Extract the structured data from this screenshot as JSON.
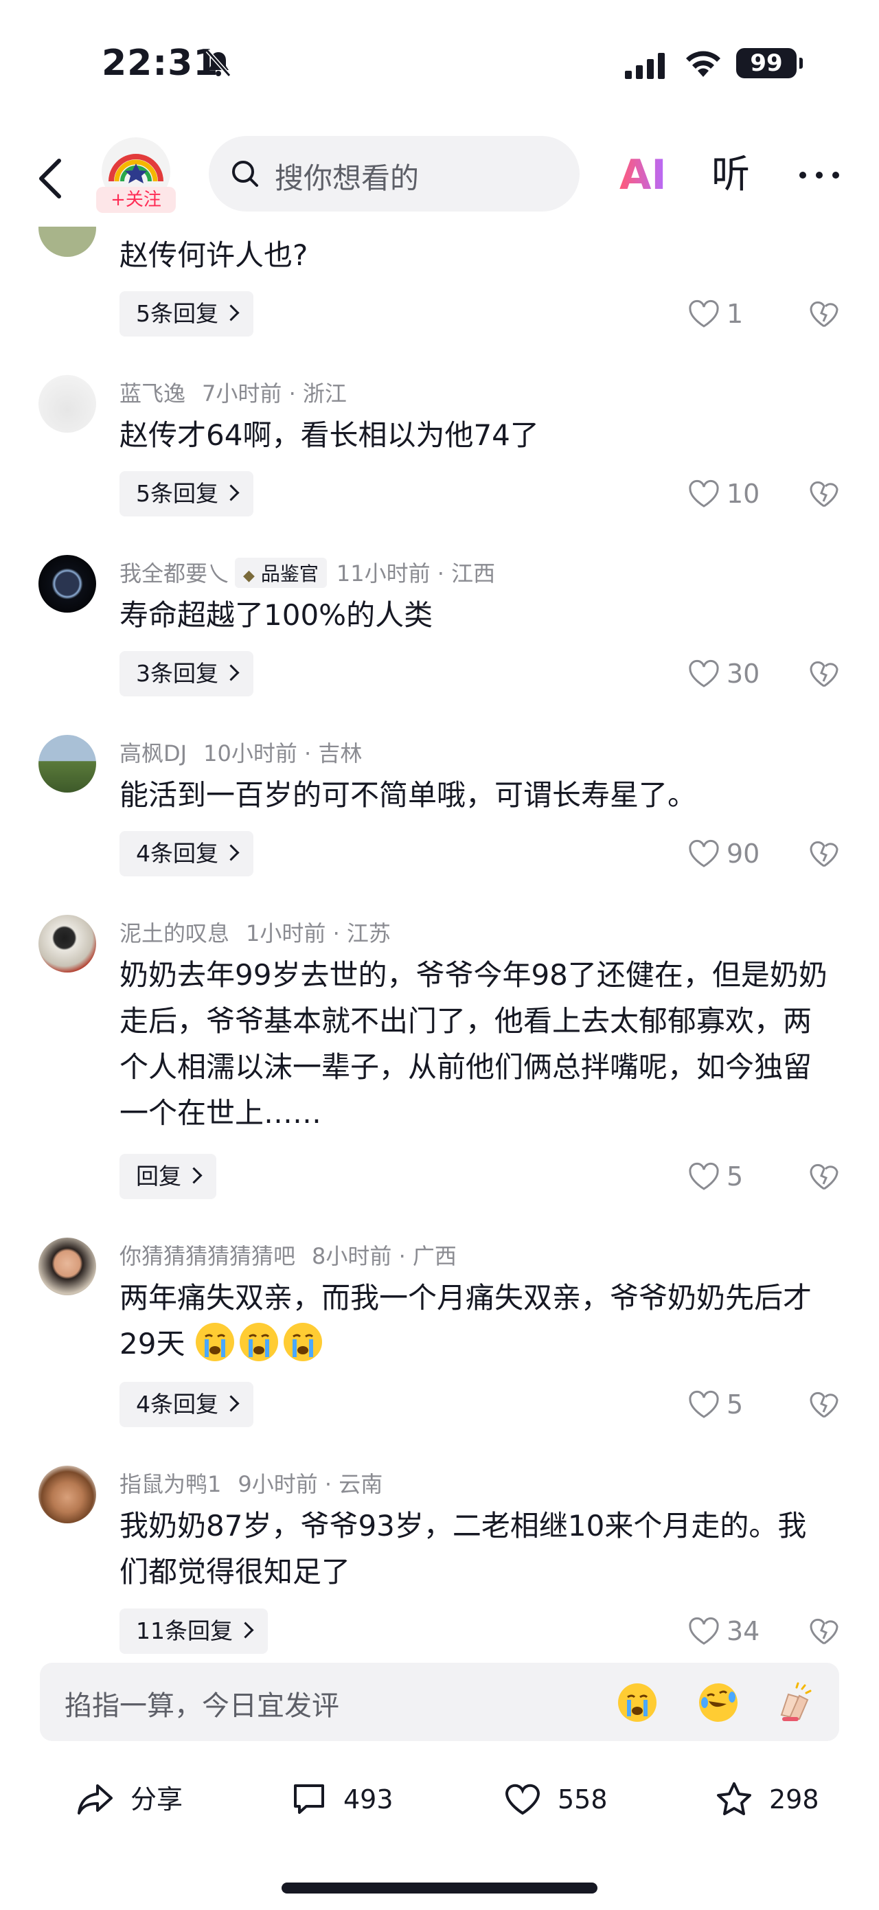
{
  "status": {
    "time": "22:31",
    "battery": "99"
  },
  "nav": {
    "follow_label": "+关注",
    "search_placeholder": "搜你想看的",
    "ai_label": "AI",
    "listen_label": "听"
  },
  "comments": [
    {
      "text": "赵传何许人也?",
      "replies": "5条回复",
      "likes": "1"
    },
    {
      "user": "蓝飞逸",
      "time": "7小时前",
      "location": "浙江",
      "text": "赵传才64啊，看长相以为他74了",
      "replies": "5条回复",
      "likes": "10"
    },
    {
      "user": "我全都要乀",
      "badge": "品鉴官",
      "time": "11小时前",
      "location": "江西",
      "text": "寿命超越了100%的人类",
      "replies": "3条回复",
      "likes": "30"
    },
    {
      "user": "高枫DJ",
      "time": "10小时前",
      "location": "吉林",
      "text": "能活到一百岁的可不简单哦，可谓长寿星了。",
      "replies": "4条回复",
      "likes": "90"
    },
    {
      "user": "泥土的叹息",
      "time": "1小时前",
      "location": "江苏",
      "text": "奶奶去年99岁去世的，爷爷今年98了还健在，但是奶奶走后，爷爷基本就不出门了，他看上去太郁郁寡欢，两个人相濡以沫一辈子，从前他们俩总拌嘴呢，如今独留一个在世上……",
      "replies": "回复",
      "likes": "5"
    },
    {
      "user": "你猜猜猜猜猜猜吧",
      "time": "8小时前",
      "location": "广西",
      "text": "两年痛失双亲，而我一个月痛失双亲，爷爷奶奶先后才29天",
      "replies": "4条回复",
      "likes": "5"
    },
    {
      "user": "指鼠为鸭1",
      "time": "9小时前",
      "location": "云南",
      "text": "我奶奶87岁，爷爷93岁，二老相继10来个月走的。我们都觉得很知足了",
      "replies": "11条回复",
      "likes": "34"
    }
  ],
  "comment_input": {
    "placeholder": "掐指一算，今日宜发评"
  },
  "bottom_bar": {
    "share_label": "分享",
    "comments": "493",
    "likes": "558",
    "favorites": "298"
  },
  "colors": {
    "accent": "#fe2c55",
    "text_primary": "#161823",
    "text_secondary": "#8a8b91",
    "chip_bg": "#f2f2f4"
  }
}
